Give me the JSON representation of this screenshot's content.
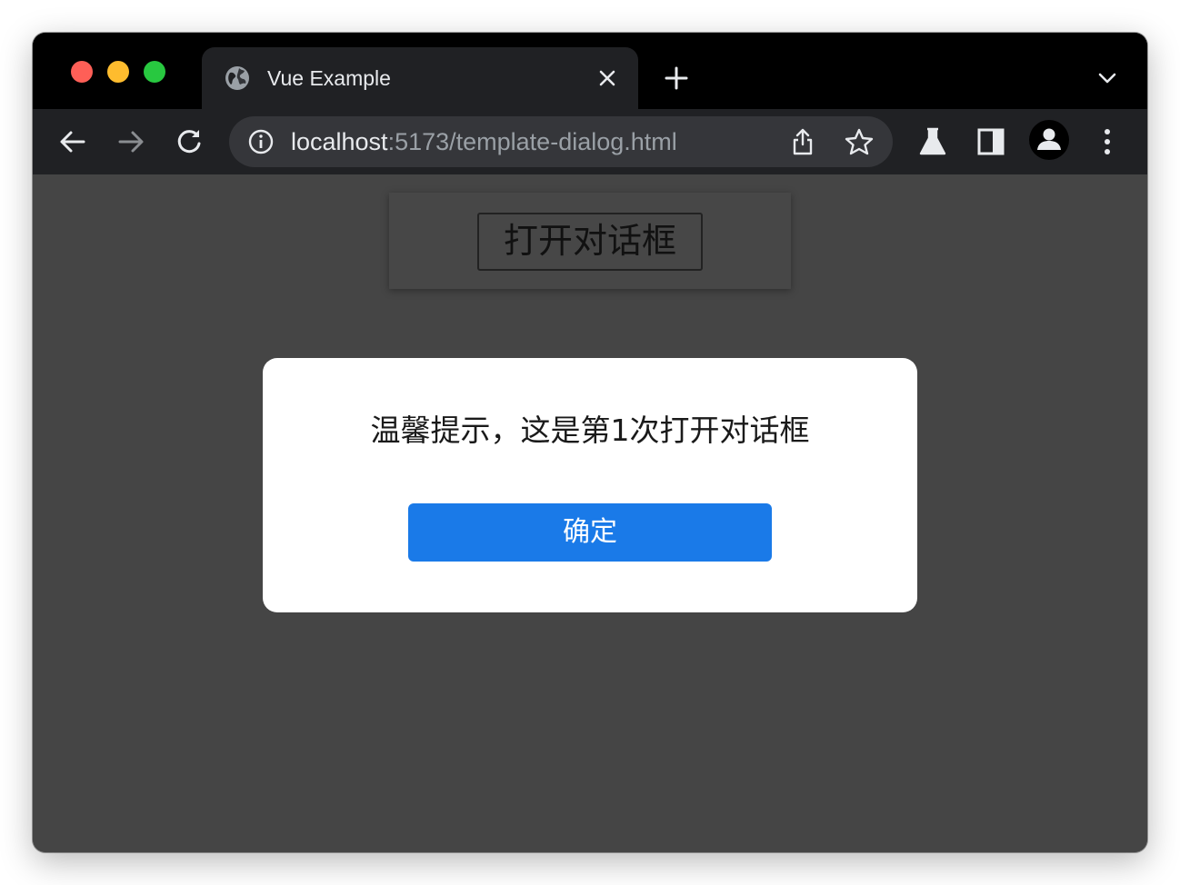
{
  "browser": {
    "tab": {
      "title": "Vue Example",
      "favicon": "globe-icon"
    },
    "address": {
      "host": "localhost",
      "rest": ":5173/template-dialog.html"
    },
    "toolbar_icons": [
      "back-arrow-icon",
      "forward-arrow-icon",
      "reload-icon",
      "info-icon",
      "share-icon",
      "bookmark-star-icon",
      "labs-flask-icon",
      "side-panel-icon",
      "profile-icon",
      "kebab-menu-icon"
    ]
  },
  "page": {
    "open_button_label": "打开对话框",
    "dialog": {
      "message": "温馨提示，这是第1次打开对话框",
      "confirm_label": "确定"
    }
  },
  "colors": {
    "page_background": "#454545",
    "dialog_background": "#ffffff",
    "confirm_button": "#1a7ae8"
  }
}
